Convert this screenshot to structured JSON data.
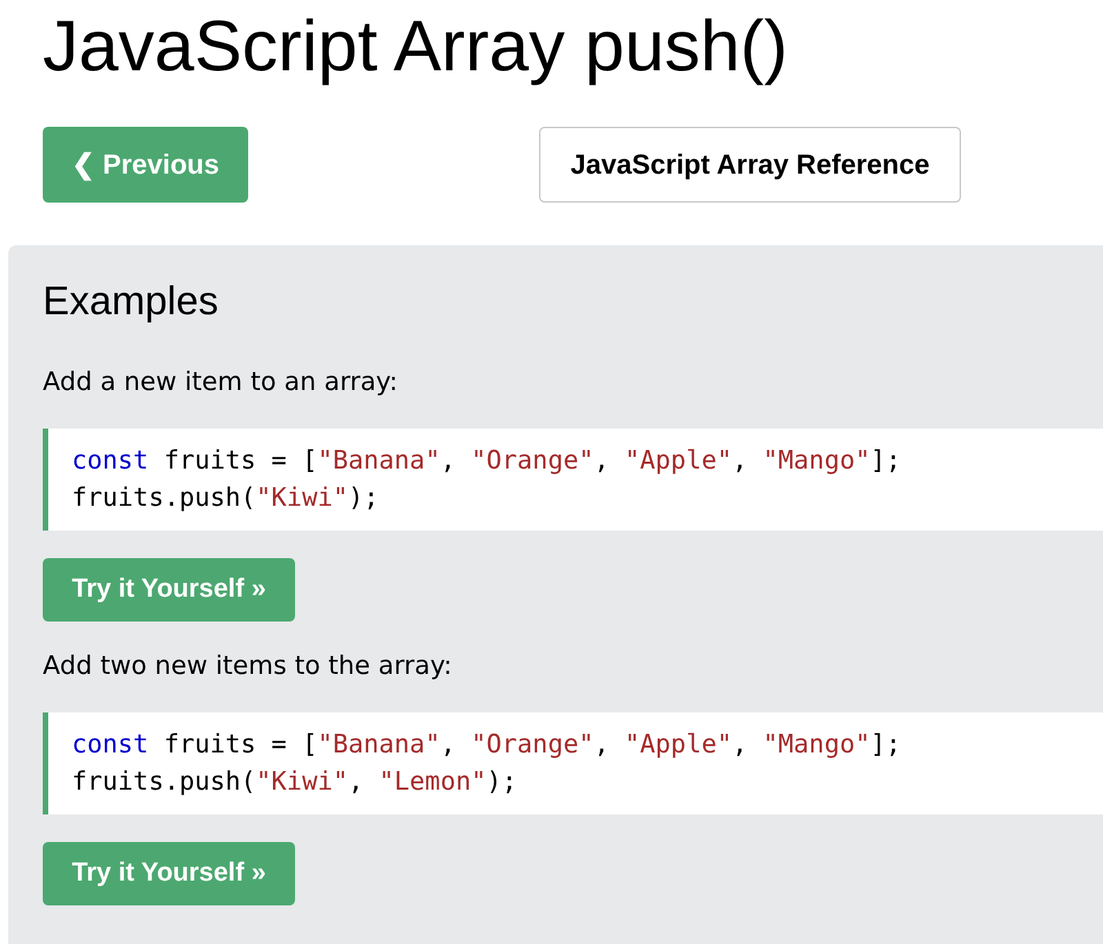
{
  "title": "JavaScript Array push()",
  "nav": {
    "previous_button": "❮ Previous",
    "reference_button": "JavaScript Array Reference"
  },
  "examples_panel": {
    "heading": "Examples",
    "examples": [
      {
        "description": "Add a new item to an array:",
        "code_lines": [
          [
            {
              "kind": "keyword",
              "text": "const"
            },
            {
              "kind": "plain",
              "text": " fruits = ["
            },
            {
              "kind": "string",
              "text": "\"Banana\""
            },
            {
              "kind": "plain",
              "text": ", "
            },
            {
              "kind": "string",
              "text": "\"Orange\""
            },
            {
              "kind": "plain",
              "text": ", "
            },
            {
              "kind": "string",
              "text": "\"Apple\""
            },
            {
              "kind": "plain",
              "text": ", "
            },
            {
              "kind": "string",
              "text": "\"Mango\""
            },
            {
              "kind": "plain",
              "text": "];"
            }
          ],
          [
            {
              "kind": "plain",
              "text": "fruits.push("
            },
            {
              "kind": "string",
              "text": "\"Kiwi\""
            },
            {
              "kind": "plain",
              "text": ");"
            }
          ]
        ],
        "button": "Try it Yourself »"
      },
      {
        "description": "Add two new items to the array:",
        "code_lines": [
          [
            {
              "kind": "keyword",
              "text": "const"
            },
            {
              "kind": "plain",
              "text": " fruits = ["
            },
            {
              "kind": "string",
              "text": "\"Banana\""
            },
            {
              "kind": "plain",
              "text": ", "
            },
            {
              "kind": "string",
              "text": "\"Orange\""
            },
            {
              "kind": "plain",
              "text": ", "
            },
            {
              "kind": "string",
              "text": "\"Apple\""
            },
            {
              "kind": "plain",
              "text": ", "
            },
            {
              "kind": "string",
              "text": "\"Mango\""
            },
            {
              "kind": "plain",
              "text": "];"
            }
          ],
          [
            {
              "kind": "plain",
              "text": "fruits.push("
            },
            {
              "kind": "string",
              "text": "\"Kiwi\""
            },
            {
              "kind": "plain",
              "text": ", "
            },
            {
              "kind": "string",
              "text": "\"Lemon\""
            },
            {
              "kind": "plain",
              "text": ");"
            }
          ]
        ],
        "button": "Try it Yourself »"
      }
    ]
  }
}
